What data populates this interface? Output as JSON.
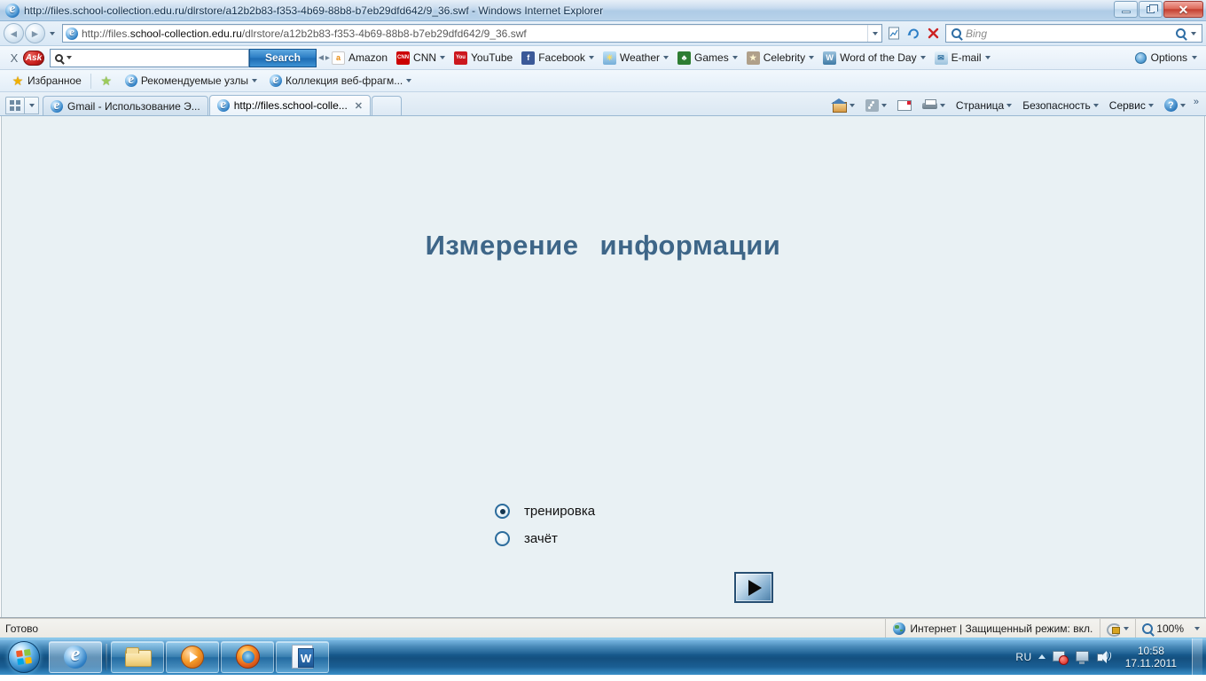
{
  "window": {
    "title": "http://files.school-collection.edu.ru/dlrstore/a12b2b83-f353-4b69-88b8-b7eb29dfd642/9_36.swf - Windows Internet Explorer",
    "minimize_label": "Свернуть",
    "maximize_label": "Развернуть",
    "close_label": "Закрыть"
  },
  "address_bar": {
    "url_prefix": "http://files.",
    "url_domain": "school-collection.edu.ru",
    "url_path": "/dlrstore/a12b2b83-f353-4b69-88b8-b7eb29dfd642/9_36.swf",
    "back_glyph": "◄",
    "forward_glyph": "►",
    "stop_glyph": "✕",
    "refresh_glyph": "↻"
  },
  "search_bar": {
    "placeholder": "Bing"
  },
  "ask_toolbar": {
    "close_label": "X",
    "logo_label": "Ask",
    "input_value": "",
    "search_button": "Search",
    "links": [
      {
        "label": "Amazon",
        "icon": "amazon-icon",
        "color": "#ff9900",
        "glyph": "a",
        "has_caret": false
      },
      {
        "label": "CNN",
        "icon": "cnn-icon",
        "color": "#cc0000",
        "glyph": "CNN",
        "has_caret": true
      },
      {
        "label": "YouTube",
        "icon": "youtube-icon",
        "color": "#cc181e",
        "glyph": "You",
        "has_caret": false
      },
      {
        "label": "Facebook",
        "icon": "facebook-icon",
        "color": "#3b5998",
        "glyph": "f",
        "has_caret": true
      },
      {
        "label": "Weather",
        "icon": "weather-icon",
        "color": "#7fb7dd",
        "glyph": "☀",
        "has_caret": true
      },
      {
        "label": "Games",
        "icon": "games-icon",
        "color": "#2e7d32",
        "glyph": "♣",
        "has_caret": true
      },
      {
        "label": "Celebrity",
        "icon": "celebrity-icon",
        "color": "#b0a08a",
        "glyph": "★",
        "has_caret": true
      },
      {
        "label": "Word of the Day",
        "icon": "word-icon",
        "color": "#4a7fa8",
        "glyph": "W",
        "has_caret": true
      },
      {
        "label": "E-mail",
        "icon": "email-icon",
        "color": "#8fb6d4",
        "glyph": "✉",
        "has_caret": true
      }
    ],
    "options_label": "Options"
  },
  "favorites_bar": {
    "favorites_label": "Избранное",
    "items": [
      {
        "label": "Рекомендуемые узлы",
        "has_caret": true
      },
      {
        "label": "Коллекция веб-фрагм...",
        "has_caret": true
      }
    ]
  },
  "tabs": {
    "quick_tabs_label": "Быстрые вкладки",
    "items": [
      {
        "label": "Gmail - Использование Э...",
        "active": false,
        "closable": false
      },
      {
        "label": "http://files.school-colle...",
        "active": true,
        "closable": true,
        "close_glyph": "✕"
      }
    ]
  },
  "command_bar": {
    "items": [
      {
        "label": "",
        "icon": "home-icon",
        "has_caret": true
      },
      {
        "label": "",
        "icon": "feeds-icon",
        "has_caret": true
      },
      {
        "label": "",
        "icon": "mail-icon",
        "has_caret": false
      },
      {
        "label": "",
        "icon": "print-icon",
        "has_caret": true
      },
      {
        "label": "Страница",
        "icon": "",
        "has_caret": true
      },
      {
        "label": "Безопасность",
        "icon": "",
        "has_caret": true
      },
      {
        "label": "Сервис",
        "icon": "",
        "has_caret": true
      },
      {
        "label": "",
        "icon": "help-icon",
        "has_caret": true
      }
    ],
    "overflow_glyph": "»"
  },
  "page": {
    "title_part1": "Измерение",
    "title_part2": "информации",
    "title_color": "#3e6688",
    "background_color": "#e9f1f4",
    "mode_options": [
      {
        "label": "тренировка",
        "selected": true
      },
      {
        "label": "зачёт",
        "selected": false
      }
    ],
    "play_button_label": "Начать"
  },
  "status_bar": {
    "status_text": "Готово",
    "zone_text": "Интернет | Защищенный режим: вкл.",
    "zoom_level": "100%"
  },
  "taskbar": {
    "start_label": "Пуск",
    "buttons": [
      {
        "name": "internet-explorer",
        "icon": "ie-icon"
      },
      {
        "name": "windows-explorer",
        "icon": "folder-icon"
      },
      {
        "name": "windows-media-player",
        "icon": "media-player-icon"
      },
      {
        "name": "mozilla-firefox",
        "icon": "firefox-icon"
      },
      {
        "name": "microsoft-word",
        "icon": "word-icon"
      }
    ],
    "tray": {
      "language": "RU",
      "time": "10:58",
      "date": "17.11.2011"
    }
  }
}
